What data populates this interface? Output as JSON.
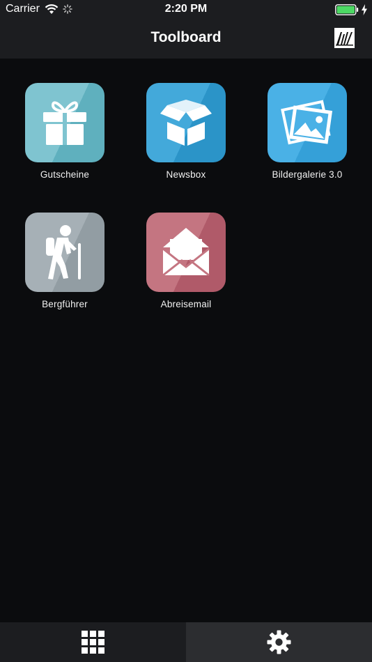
{
  "status_bar": {
    "carrier": "Carrier",
    "time": "2:20 PM",
    "icons": [
      "wifi-icon",
      "activity-spinner-icon",
      "battery-icon",
      "charging-bolt-icon"
    ],
    "battery_color": "#4cd964"
  },
  "nav_bar": {
    "title": "Toolboard",
    "logo_icon": "brand-logo-icon"
  },
  "tiles": [
    {
      "label": "Gutscheine",
      "icon": "gift-icon",
      "color": "#6ab5c3"
    },
    {
      "label": "Newsbox",
      "icon": "open-box-icon",
      "color": "#2f9bd0"
    },
    {
      "label": "Bildergalerie 3.0",
      "icon": "photo-gallery-icon",
      "color": "#38a6de"
    },
    {
      "label": "Bergführer",
      "icon": "hiker-icon",
      "color": "#97a2a8"
    },
    {
      "label": "Abreisemail",
      "icon": "open-envelope-icon",
      "color": "#b6606f"
    }
  ],
  "tab_bar": {
    "items": [
      {
        "name": "apps",
        "icon": "grid-icon",
        "selected": true
      },
      {
        "name": "settings",
        "icon": "gear-icon",
        "selected": false
      }
    ]
  }
}
